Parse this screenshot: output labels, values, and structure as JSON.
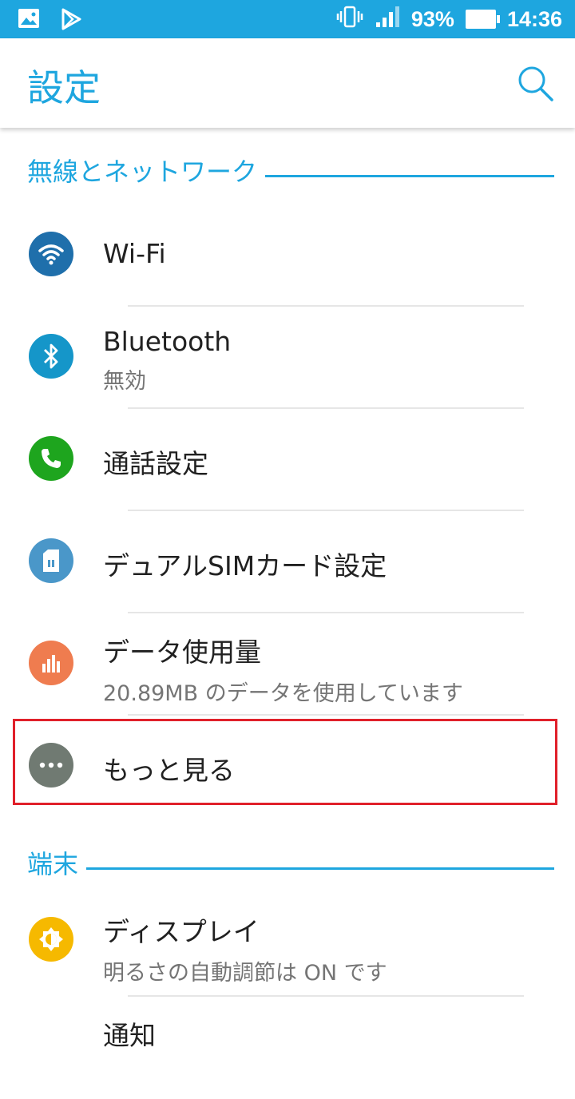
{
  "status_bar": {
    "left_icons": [
      "image-icon",
      "play-store-icon"
    ],
    "right_icons": [
      "vibrate-icon",
      "signal-icon",
      "battery-icon"
    ],
    "battery": "93%",
    "time": "14:36",
    "background": "#1ea6df"
  },
  "app_bar": {
    "title": "設定",
    "search_icon": "search-icon",
    "accent": "#1ea6df"
  },
  "sections": [
    {
      "header": "無線とネットワーク",
      "items": [
        {
          "label": "Wi-Fi",
          "icon": "wifi-icon",
          "color": "#1f6fab"
        },
        {
          "label": "Bluetooth",
          "summary": "無効",
          "icon": "bluetooth-icon",
          "color": "#1596c9"
        },
        {
          "label": "通話設定",
          "icon": "phone-icon",
          "color": "#1ea51e"
        },
        {
          "label": "デュアルSIMカード設定",
          "icon": "sim-card-icon",
          "color": "#4a97c9"
        },
        {
          "label": "データ使用量",
          "summary": "20.89MB のデータを使用しています",
          "icon": "data-usage-icon",
          "color": "#ef7c4f"
        },
        {
          "label": "もっと見る",
          "icon": "more-icon",
          "color": "#707a72"
        }
      ]
    },
    {
      "header": "端末",
      "items": [
        {
          "label": "ディスプレイ",
          "summary": "明るさの自動調節は ON です",
          "icon": "brightness-icon",
          "color": "#f6b900"
        },
        {
          "label": "通知",
          "icon": "notification-icon",
          "color": "#1ea6df"
        }
      ]
    }
  ],
  "highlight_color": "#e0202a"
}
